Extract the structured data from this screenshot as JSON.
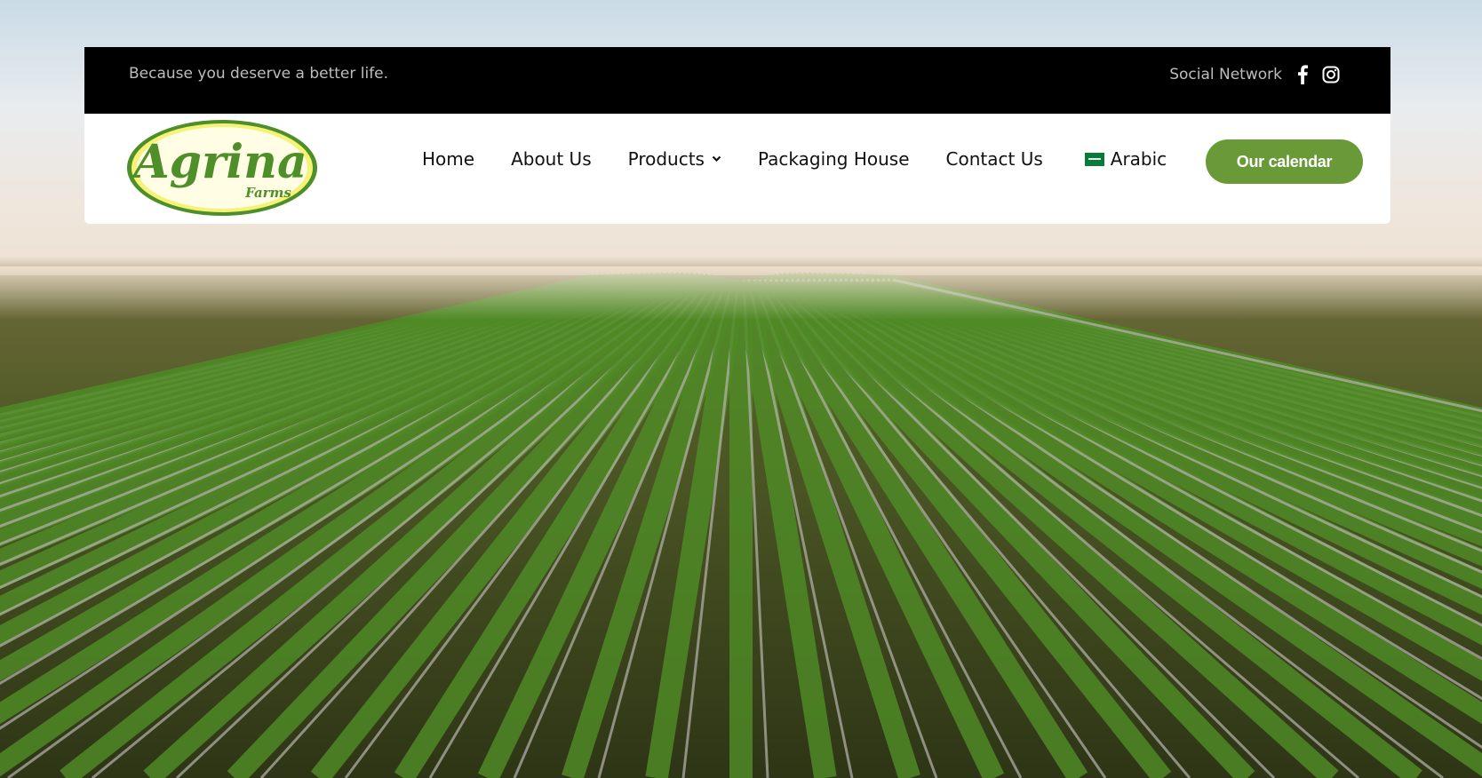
{
  "topbar": {
    "tagline": "Because you deserve a better life.",
    "social_label": "Social Network",
    "icons": [
      "facebook-icon",
      "instagram-icon"
    ]
  },
  "logo": {
    "text": "Agrina",
    "subtext": "Farms"
  },
  "nav": {
    "items": [
      "Home",
      "About Us",
      "Products",
      "Packaging House",
      "Contact Us"
    ],
    "language_label": "Arabic",
    "cta_label": "Our calendar"
  },
  "colors": {
    "accent": "#6a9a38",
    "logo_green": "#4f8f2a",
    "logo_yellow": "#f4f277",
    "topbar": "#000000"
  }
}
